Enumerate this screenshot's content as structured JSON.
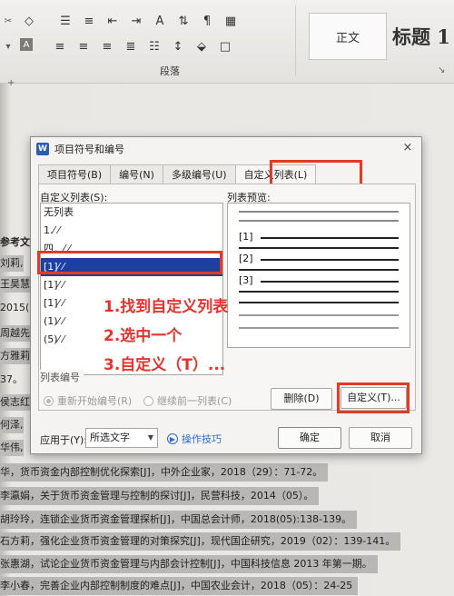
{
  "ribbon": {
    "group_label": "段落",
    "style_normal": "正文",
    "style_heading": "标题 1",
    "icons_row1": [
      "scissors-icon",
      "eraser-icon",
      "list-bullets-icon",
      "list-numbers-icon",
      "outdent-icon",
      "indent-icon",
      "text-direction-icon",
      "sort-icon",
      "show-marks-icon",
      "borders-icon"
    ],
    "icons_row2": [
      "brush-icon",
      "font-a-icon",
      "align-left-icon",
      "align-center-icon",
      "align-right-icon",
      "justify-icon",
      "distribute-icon",
      "line-spacing-icon",
      "shading-icon",
      "border-box-icon"
    ]
  },
  "document": {
    "left_fragments": [
      "参考文",
      "刘莉,",
      "王昊慧",
      "2015(",
      "周越先",
      "方雅莉",
      "37。",
      "侯志红",
      "何泽,",
      "华伟,"
    ],
    "lines": [
      "华，货币资金内部控制优化探索[J]，中外企业家，2018（29）：71-72。",
      "李瀛娟，关于货币资金管理与控制的探讨[J]，民营科技，2014（05）。",
      "胡玲玲，连锁企业货币资金管理探析[J]，中国总会计师，2018(05):138-139。",
      "石方莉，强化企业货币资金管理的对策探究[J]，现代国企研究，2019（02）：139-141。",
      "张惠湖，试论企业货币资金管理与内部会计控制[J]，中国科技信息 2013 年第一期。",
      "李小春，完善企业内部控制制度的难点[J]，中国农业会计，2018（05）：24-25"
    ]
  },
  "dialog": {
    "title": "项目符号和编号",
    "close": "×",
    "tabs": [
      "项目符号(B)",
      "编号(N)",
      "多级编号(U)",
      "自定义列表(L)"
    ],
    "list_label": "自定义列表(S):",
    "preview_label": "列表预览:",
    "list_items": [
      "无列表",
      "1.⁄ ⁄",
      "四．⁄ ⁄",
      "[1]⁄ ⁄",
      "[1]⁄ ⁄",
      "[1]⁄ ⁄",
      "(1)⁄ ⁄",
      "(5)⁄ ⁄"
    ],
    "preview_items": [
      "[1]",
      "[2]",
      "[3]"
    ],
    "annotations": [
      "1.找到自定义列表",
      "2.选中一个",
      "3.自定义（T）..."
    ],
    "group_label": "列表编号",
    "radio_restart": "重新开始编号(R)",
    "radio_continue": "继续前一列表(C)",
    "delete_button": "删除(D)",
    "customize_button": "自定义(T)...",
    "apply_label": "应用于(Y):",
    "apply_value": "所选文字",
    "tips_link": "操作技巧",
    "ok_button": "确定",
    "cancel_button": "取消"
  },
  "colors": {
    "highlight": "#e43a22",
    "selection": "#1d3fa0",
    "annotation": "#e8322a"
  }
}
